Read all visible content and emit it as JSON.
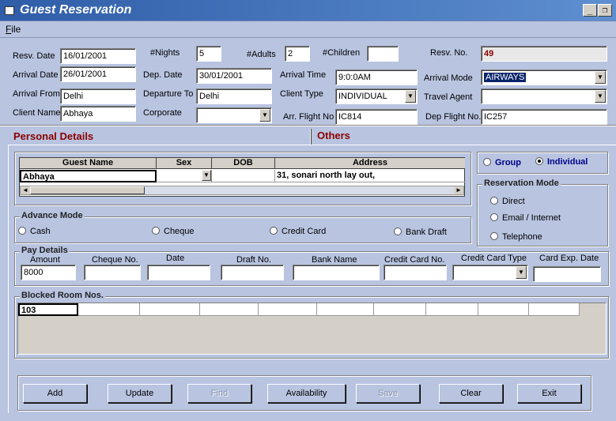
{
  "window": {
    "title": "Guest Reservation"
  },
  "menu": {
    "file": "File"
  },
  "header": {
    "resv_date_label": "Resv. Date",
    "resv_date": "16/01/2001",
    "nights_label": "#Nights",
    "nights": "5",
    "adults_label": "#Adults",
    "adults": "2",
    "children_label": "#Children",
    "children": "",
    "resv_no_label": "Resv. No.",
    "resv_no": "49",
    "arrival_date_label": "Arrival Date",
    "arrival_date": "26/01/2001",
    "dep_date_label": "Dep. Date",
    "dep_date": "30/01/2001",
    "arrival_time_label": "Arrival Time",
    "arrival_time": "9:0:0AM",
    "arrival_mode_label": "Arrival Mode",
    "arrival_mode": "AIRWAYS",
    "arrival_from_label": "Arrival From",
    "arrival_from": "Delhi",
    "departure_to_label": "Departure To",
    "departure_to": "Delhi",
    "client_type_label": "Client Type",
    "client_type": "INDIVIDUAL",
    "travel_agent_label": "Travel Agent",
    "travel_agent": "",
    "client_name_label": "Client Name",
    "client_name": "Abhaya",
    "corporate_label": "Corporate",
    "corporate": "",
    "arr_flight_label": "Arr. Flight No",
    "arr_flight": "IC814",
    "dep_flight_label": "Dep Flight No.",
    "dep_flight": "IC257"
  },
  "tabs": {
    "personal": "Personal Details",
    "others": "Others"
  },
  "guest_grid": {
    "columns": [
      "Guest Name",
      "Sex",
      "DOB",
      "Address"
    ],
    "row": {
      "name": "Abhaya",
      "sex": "",
      "dob": "",
      "address": "31, sonari north lay out,"
    }
  },
  "group_type": {
    "group": "Group",
    "individual": "Individual"
  },
  "reservation_mode": {
    "title": "Reservation Mode",
    "direct": "Direct",
    "email": "Email / Internet",
    "telephone": "Telephone"
  },
  "advance_mode": {
    "title": "Advance Mode",
    "cash": "Cash",
    "cheque": "Cheque",
    "credit_card": "Credit Card",
    "bank_draft": "Bank Draft"
  },
  "pay_details": {
    "title": "Pay Details",
    "amount_label": "Amount",
    "amount": "8000",
    "cheque_no_label": "Cheque No.",
    "date_label": "Date",
    "draft_no_label": "Draft No.",
    "bank_name_label": "Bank Name",
    "credit_card_no_label": "Credit Card No.",
    "credit_card_type_label": "Credit Card Type",
    "card_exp_label": "Card Exp. Date"
  },
  "blocked_rooms": {
    "title": "Blocked Room Nos.",
    "first": "103"
  },
  "buttons": {
    "add": "Add",
    "update": "Update",
    "find": "Find",
    "availability": "Availability",
    "save": "Save",
    "clear": "Clear",
    "exit": "Exit"
  },
  "colors": {
    "resv_no": "#8b0000",
    "tab_text": "#8b0000",
    "radio_text": "#00008b"
  }
}
